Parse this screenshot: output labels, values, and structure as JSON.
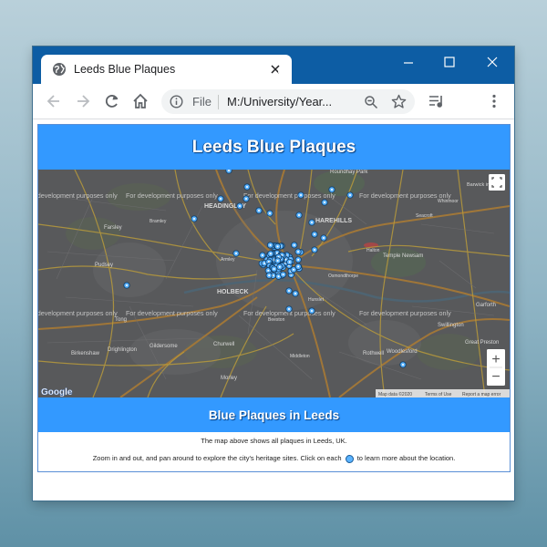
{
  "browser": {
    "tab_title": "Leeds Blue Plaques",
    "omnibox": {
      "scheme_label": "File",
      "url": "M:/University/Year..."
    }
  },
  "page": {
    "title": "Leeds Blue Plaques",
    "subtitle": "Blue Plaques in Leeds",
    "description_1": "The map above shows all plaques in Leeds, UK.",
    "description_2_before": "Zoom in and out, and pan around to explore the city's heritage sites. Click on each",
    "description_2_after": "to learn more about the location."
  },
  "map": {
    "watermark": "For development purposes only",
    "place_labels": [
      "HEADINGLEY",
      "HAREHILLS",
      "HOLBECK",
      "Temple Newsam",
      "Roundhay Park",
      "Barwick in Elmet",
      "Farsley",
      "Pudsey",
      "Tong",
      "Drighlington",
      "Gildersome",
      "Churwell",
      "Morley",
      "Birkenshaw",
      "Rothwell",
      "Woodlesford",
      "Swillington",
      "Great Preston",
      "Garforth",
      "Beeston",
      "Hunslet",
      "Armley",
      "Bramley",
      "Seacroft",
      "Whinmoor",
      "Halton",
      "Middleton",
      "Osmondthorpe"
    ],
    "attribution": [
      "Map data ©2020",
      "Terms of Use",
      "Report a map error"
    ],
    "zoom_in_label": "+",
    "zoom_out_label": "−",
    "google_logo": "Google"
  },
  "colors": {
    "titlebar": "#0d5da4",
    "banner": "#3399ff",
    "marker": "#5bb3ff",
    "road_yellow": "#b89a3c",
    "road_orange": "#a87a35"
  },
  "icons": [
    "globe-icon",
    "close-icon",
    "plus-icon",
    "minimize-icon",
    "maximize-icon",
    "back-icon",
    "forward-icon",
    "reload-icon",
    "home-icon",
    "info-icon",
    "zoom-icon",
    "star-icon",
    "reading-list-icon",
    "menu-icon",
    "fullscreen-icon",
    "marker-icon"
  ]
}
